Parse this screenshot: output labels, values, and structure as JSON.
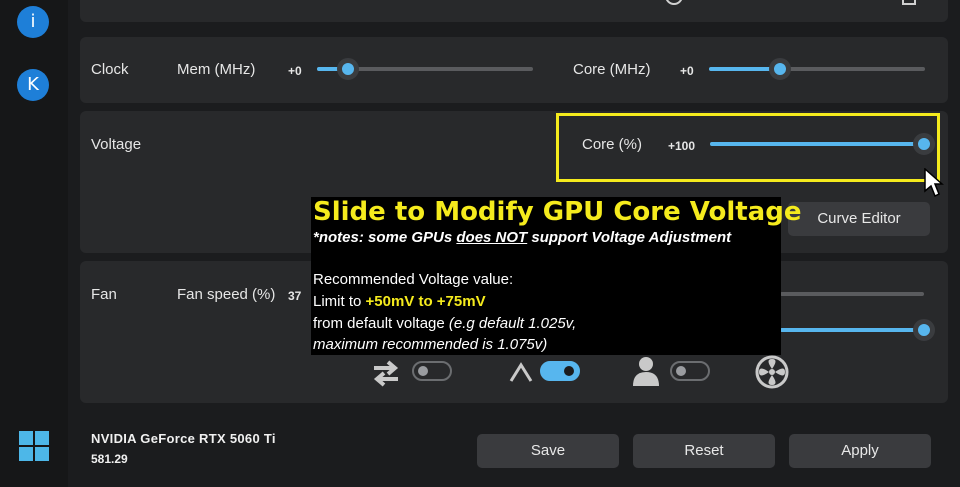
{
  "sidebar": {
    "info_label": "i",
    "profile_label": "K"
  },
  "clock": {
    "label": "Clock",
    "mem_label": "Mem (MHz)",
    "mem_value": "+0",
    "core_label": "Core (MHz)",
    "core_value": "+0"
  },
  "voltage": {
    "label": "Voltage",
    "core_label": "Core (%)",
    "core_value": "+100",
    "curve_editor_label": "Curve Editor"
  },
  "fan": {
    "label": "Fan",
    "speed_label": "Fan speed (%)",
    "speed_value": "37"
  },
  "overlay": {
    "title": "Slide to Modify GPU Core Voltage",
    "note_prefix": "*notes: some GPUs ",
    "note_emph": "does NOT",
    "note_suffix": " support Voltage Adjustment",
    "line1": "Recommended Voltage value:",
    "line2_prefix": "Limit to ",
    "line2_highlight": "+50mV to +75mV",
    "line3_prefix": "from default voltage ",
    "line3_italic": "(e.g default 1.025v,",
    "line4": "maximum recommended is 1.075v)"
  },
  "gpu": {
    "name": "NVIDIA GeForce RTX 5060 Ti",
    "driver": "581.29"
  },
  "buttons": {
    "save": "Save",
    "reset": "Reset",
    "apply": "Apply"
  },
  "colors": {
    "accent": "#57b6ee",
    "highlight": "#f5eb1d",
    "panel": "#28292b"
  }
}
